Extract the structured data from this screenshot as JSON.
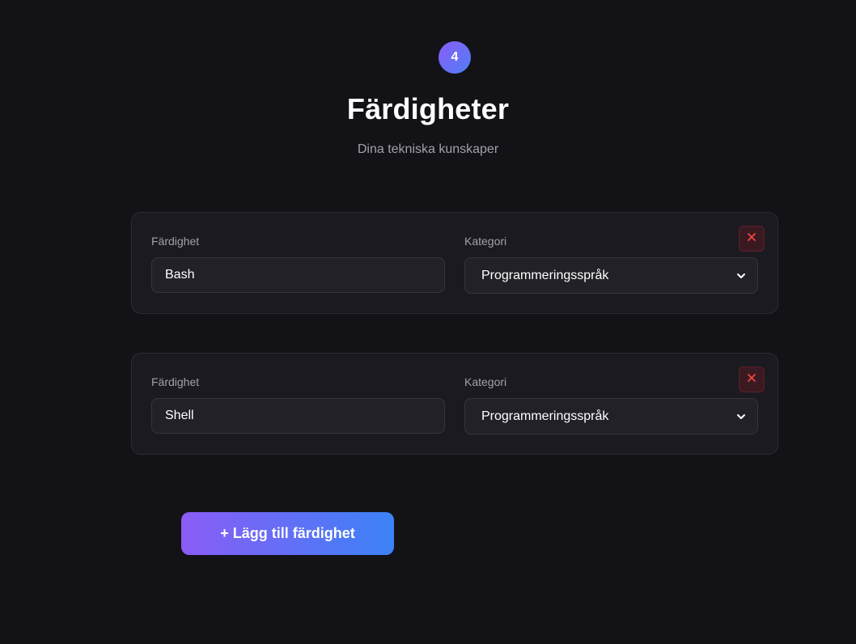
{
  "step": {
    "number": "4"
  },
  "header": {
    "title": "Färdigheter",
    "subtitle": "Dina tekniska kunskaper"
  },
  "skills": [
    {
      "skill_label": "Färdighet",
      "skill_value": "Bash",
      "category_label": "Kategori",
      "category_value": "Programmeringsspråk"
    },
    {
      "skill_label": "Färdighet",
      "skill_value": "Shell",
      "category_label": "Kategori",
      "category_value": "Programmeringsspråk"
    }
  ],
  "actions": {
    "add_skill_label": "+ Lägg till färdighet"
  },
  "colors": {
    "background": "#131217",
    "card": "#1b1a20",
    "accent_start": "#8b5cf6",
    "accent_end": "#3b82f6",
    "danger": "#ef4444"
  }
}
